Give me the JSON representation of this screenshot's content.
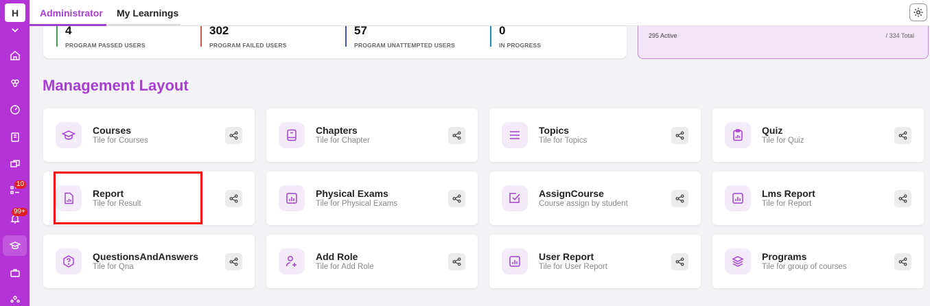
{
  "brand": {
    "logo_letter": "H"
  },
  "sidebar": {
    "icons": [
      "chevron-down-icon",
      "home-icon",
      "groups-icon",
      "dashboard-icon",
      "book-icon",
      "chat-icon",
      "list-icon",
      "bell-icon",
      "graduation-cap-icon",
      "briefcase-icon",
      "users-icon"
    ],
    "badges": {
      "list": "10",
      "notifications": "99+"
    }
  },
  "tabs": [
    {
      "label": "Administrator",
      "active": true
    },
    {
      "label": "My Learnings",
      "active": false
    }
  ],
  "stats": [
    {
      "value": "4",
      "label": "PROGRAM PASSED USERS",
      "color": "#3fa34d"
    },
    {
      "value": "302",
      "label": "PROGRAM FAILED USERS",
      "color": "#d9534f"
    },
    {
      "value": "57",
      "label": "PROGRAM UNATTEMPTED USERS",
      "color": "#3f51b5"
    },
    {
      "value": "0",
      "label": "IN PROGRESS",
      "color": "#1e88c8"
    }
  ],
  "active_summary": {
    "active": "295 Active",
    "total": "/ 334 Total"
  },
  "section_title": "Management Layout",
  "tiles": [
    {
      "title": "Courses",
      "subtitle": "Tile for Courses",
      "icon": "graduation-cap-icon"
    },
    {
      "title": "Chapters",
      "subtitle": "Tile for Chapter",
      "icon": "book-icon"
    },
    {
      "title": "Topics",
      "subtitle": "Tile for Topics",
      "icon": "list-icon"
    },
    {
      "title": "Quiz",
      "subtitle": "Tile for Quiz",
      "icon": "clipboard-icon"
    },
    {
      "title": "Report",
      "subtitle": "Tile for Result",
      "icon": "report-icon"
    },
    {
      "title": "Physical Exams",
      "subtitle": "Tile for Physical Exams",
      "icon": "chart-icon"
    },
    {
      "title": "AssignCourse",
      "subtitle": "Course assign by student",
      "icon": "checkbox-icon"
    },
    {
      "title": "Lms Report",
      "subtitle": "Tile for Report",
      "icon": "chart-icon"
    },
    {
      "title": "QuestionsAndAnswers",
      "subtitle": "Tile for Qna",
      "icon": "question-icon"
    },
    {
      "title": "Add Role",
      "subtitle": "Tile for Add Role",
      "icon": "add-user-icon"
    },
    {
      "title": "User Report",
      "subtitle": "Tile for User Report",
      "icon": "chart-icon"
    },
    {
      "title": "Programs",
      "subtitle": "Tile for group of courses",
      "icon": "layers-icon"
    }
  ],
  "colors": {
    "accent": "#a63fd0",
    "sidebar": "#b433d6",
    "highlight": "#ff0000"
  }
}
